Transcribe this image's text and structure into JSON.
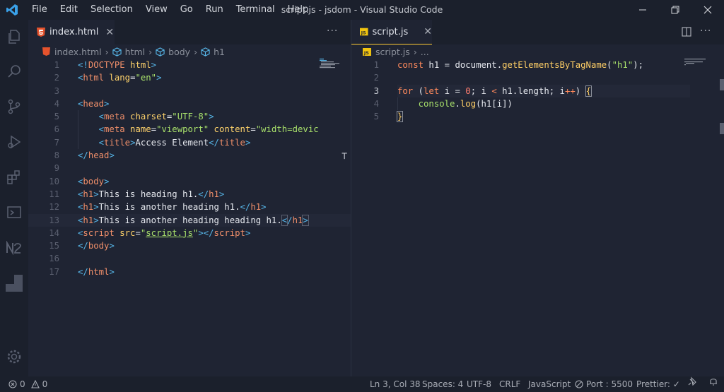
{
  "menu": [
    "File",
    "Edit",
    "Selection",
    "View",
    "Go",
    "Run",
    "Terminal",
    "Help"
  ],
  "window_title": "script.js - jsdom - Visual Studio Code",
  "left_editor": {
    "tab_label": "index.html",
    "breadcrumb": [
      "index.html",
      "html",
      "body",
      "h1"
    ],
    "line_numbers": [
      "1",
      "2",
      "3",
      "4",
      "5",
      "6",
      "7",
      "8",
      "9",
      "10",
      "11",
      "12",
      "13",
      "14",
      "15",
      "16",
      "17"
    ]
  },
  "right_editor": {
    "tab_label": "script.js",
    "breadcrumb": [
      "script.js",
      "..."
    ],
    "line_numbers": [
      "1",
      "2",
      "3",
      "4",
      "5"
    ]
  },
  "statusbar": {
    "errors": "0",
    "warnings": "0",
    "position": "Ln 3, Col 38",
    "spaces": "Spaces: 4",
    "encoding": "UTF-8",
    "eol": "CRLF",
    "language": "JavaScript",
    "port": "Port : 5500",
    "prettier": "Prettier: ✓"
  },
  "colors": {
    "accent_blue": "#57b6e8",
    "tab_underline": "#ffcc33"
  }
}
